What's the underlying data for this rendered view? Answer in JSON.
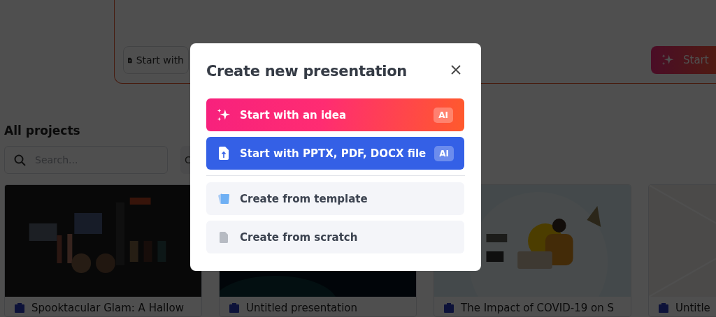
{
  "background": {
    "prompt_card": {
      "file_button": "Start with",
      "generate_button": "Start"
    },
    "section_title": "All projects",
    "search": {
      "placeholder": "Search..."
    },
    "filter_field": {
      "label": "C"
    },
    "projects": [
      {
        "title": "Spooktacular Glam: A Hallow",
        "kind": "dark"
      },
      {
        "title": "Untitled presentation",
        "kind": "navy"
      },
      {
        "title": "The Impact of COVID-19 on S",
        "kind": "light"
      },
      {
        "title": "Untitle",
        "kind": "empty"
      }
    ]
  },
  "dialog": {
    "title": "Create new presentation",
    "options": [
      {
        "kind": "idea",
        "label": "Start with an idea",
        "badge": "AI"
      },
      {
        "kind": "upload",
        "label": "Start with PPTX, PDF, DOCX file",
        "badge": "AI"
      },
      {
        "kind": "template",
        "label": "Create from template"
      },
      {
        "kind": "blank",
        "label": "Create from scratch"
      }
    ]
  }
}
